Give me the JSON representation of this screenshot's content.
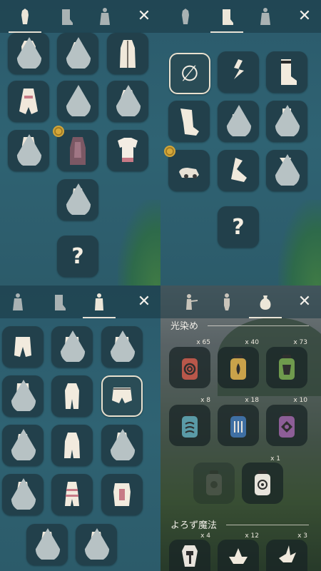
{
  "panel_outfits": {
    "close_glyph": "✕",
    "tabs": [
      "outfit-icon",
      "boots-icon",
      "cape-figure-icon"
    ],
    "unknown": "?"
  },
  "panel_shoes": {
    "close_glyph": "✕",
    "tabs": [
      "outfit-icon",
      "boots-icon",
      "cape-figure-icon"
    ],
    "none_glyph": "∅",
    "unknown": "?"
  },
  "panel_pants": {
    "close_glyph": "✕",
    "tabs": [
      "cape-figure-icon",
      "boots-icon",
      "outfit-icon"
    ]
  },
  "panel_props": {
    "close_glyph": "✕",
    "tabs": [
      "pointing-figure-icon",
      "standing-figure-icon",
      "pouch-icon"
    ],
    "dyes_label": "光染め",
    "magic_label": "よろず魔法",
    "dye_counts": [
      "x 65",
      "x 40",
      "x 73",
      "x 8",
      "x 18",
      "x 10",
      "x 1"
    ],
    "magic_counts": [
      "x 4",
      "x 12",
      "x 3"
    ],
    "colors": {
      "red": "#b8574a",
      "yellow": "#c9a24a",
      "green": "#6f9a4d",
      "cyan": "#5a9aa6",
      "blue": "#3f6fa3",
      "purple": "#8d5e97",
      "black": "#3d3d3d",
      "white": "#e8e4dc"
    }
  }
}
